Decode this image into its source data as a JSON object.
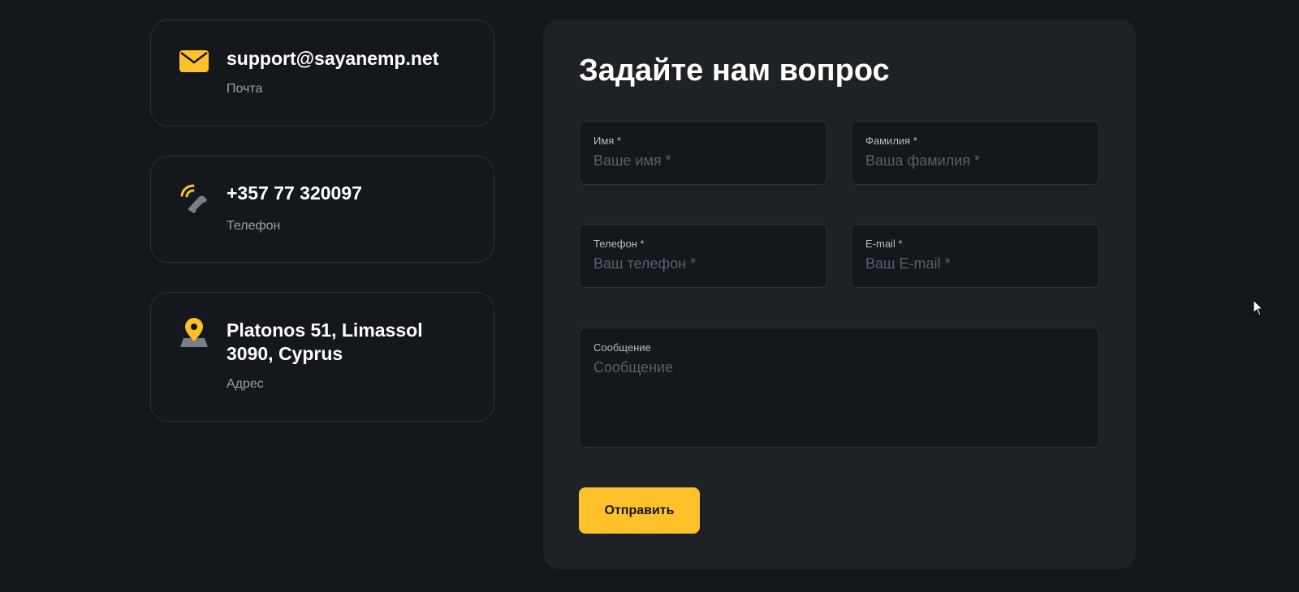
{
  "contacts": {
    "mail": {
      "value": "support@sayanemp.net",
      "caption": "Почта",
      "icon": "mail-icon"
    },
    "phone": {
      "value": "+357 77 320097",
      "caption": "Телефон",
      "icon": "phone-icon"
    },
    "address": {
      "value": "Platonos 51, Limassol 3090, Cyprus",
      "caption": "Адрес",
      "icon": "location-pin-icon"
    }
  },
  "form": {
    "title": "Задайте нам вопрос",
    "first_name": {
      "label": "Имя *",
      "placeholder": "Ваше имя *",
      "value": ""
    },
    "last_name": {
      "label": "Фамилия *",
      "placeholder": "Ваша фамилия *",
      "value": ""
    },
    "phone": {
      "label": "Телефон *",
      "placeholder": "Ваш телефон *",
      "value": ""
    },
    "email": {
      "label": "E-mail *",
      "placeholder": "Ваш E-mail *",
      "value": ""
    },
    "message": {
      "label": "Сообщение",
      "placeholder": "Сообщение",
      "value": ""
    },
    "submit_label": "Отправить"
  },
  "colors": {
    "background": "#14171c",
    "panel": "#1e2126",
    "accent": "#fec12a",
    "muted_text": "#9a9ea6"
  }
}
